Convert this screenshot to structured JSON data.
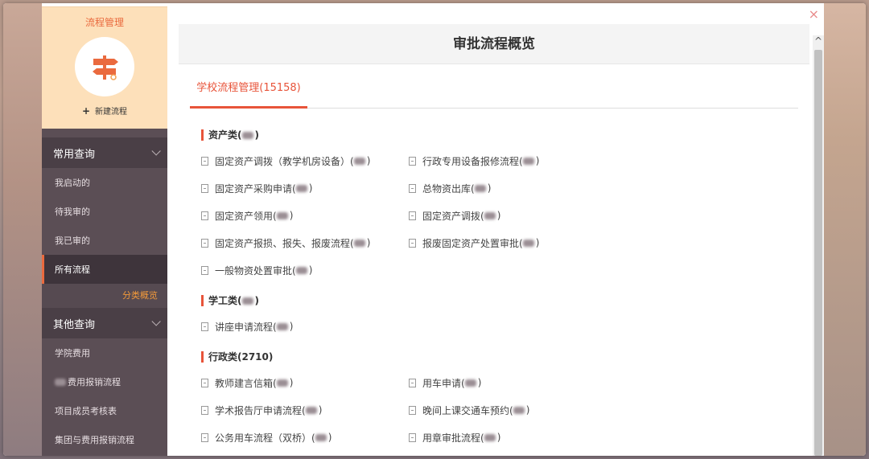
{
  "sidebar": {
    "title": "流程管理",
    "new_flow": "新建流程",
    "groups": [
      {
        "label": "常用查询",
        "items": [
          "我启动的",
          "待我审的",
          "我已审的",
          "所有流程"
        ],
        "active_index": 3,
        "sub_label": "分类概览"
      },
      {
        "label": "其他查询",
        "items": [
          "学院费用",
          "费用报销流程",
          "项目成员考核表",
          "集团与费用报销流程"
        ]
      }
    ]
  },
  "modal": {
    "title": "审批流程概览",
    "close_symbol": "×",
    "tab_label": "学校流程管理(15158)",
    "categories": [
      {
        "title": "资产类(",
        "items": [
          "固定资产调拨（教学机房设备）(",
          "行政专用设备报修流程(",
          "固定资产采购申请(",
          "总物资出库(",
          "固定资产领用(",
          "固定资产调拨(",
          "固定资产报损、报失、报废流程(",
          "报废固定资产处置审批(",
          "一般物资处置审批("
        ]
      },
      {
        "title": "学工类(",
        "items": [
          "讲座申请流程("
        ]
      },
      {
        "title": "行政类(2710)",
        "items": [
          "教师建言信箱(",
          "用车申请(",
          "学术报告厅申请流程(",
          "晚间上课交通车预约(",
          "公务用车流程（双桥）(",
          "用章审批流程("
        ]
      }
    ]
  },
  "colors": {
    "accent": "#e8543a",
    "sidebar_bg": "#5b4e55",
    "sidebar_top": "#fde0ba"
  }
}
